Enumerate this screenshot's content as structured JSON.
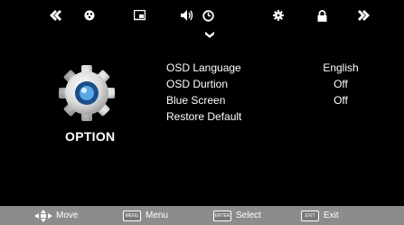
{
  "tabs": [
    {
      "icon": "chevron-double-left-icon"
    },
    {
      "icon": "picture-icon"
    },
    {
      "icon": "screen-icon"
    },
    {
      "icon": "speaker-icon"
    },
    {
      "icon": "clock-icon"
    },
    {
      "icon": "gear-icon"
    },
    {
      "icon": "lock-icon"
    },
    {
      "icon": "chevron-double-right-icon"
    }
  ],
  "page": {
    "icon": "gear-icon",
    "title": "OPTION"
  },
  "menu": {
    "items": [
      {
        "label": "OSD Language",
        "value": "English"
      },
      {
        "label": "OSD  Durtion",
        "value": "Off"
      },
      {
        "label": "Blue  Screen",
        "value": "Off"
      },
      {
        "label": "Restore Default",
        "value": ""
      }
    ]
  },
  "footer": {
    "move": "Move",
    "menu": "Menu",
    "select": "Select",
    "exit": "Exit",
    "menu_key": "MENU",
    "select_key": "ENTER",
    "exit_key": "EXIT"
  },
  "colors": {
    "background": "#000000",
    "text": "#ffffff",
    "footer_bar": "#8c8c8c"
  }
}
